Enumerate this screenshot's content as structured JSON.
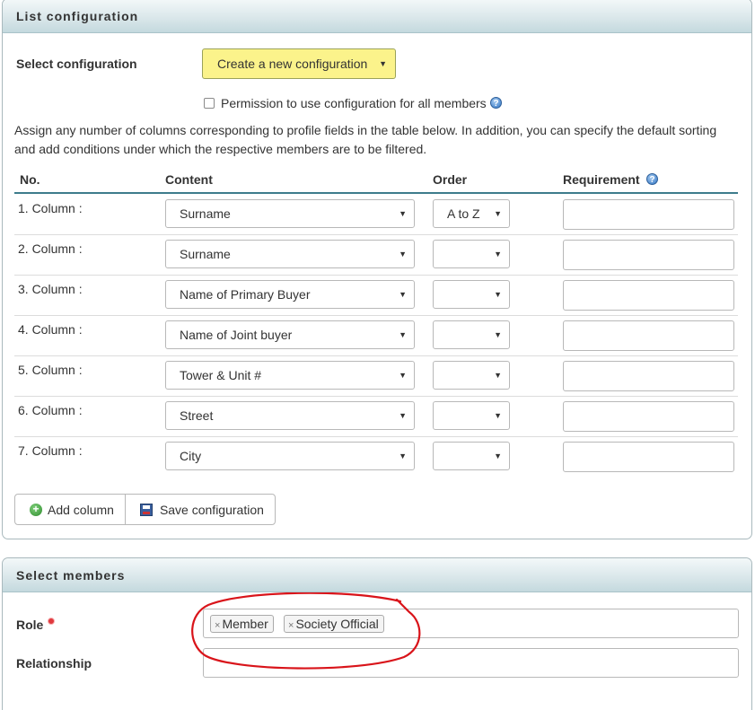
{
  "list_config": {
    "title": "List configuration",
    "select_label": "Select configuration",
    "select_value": "Create a new configuration",
    "permission_label": "Permission to use configuration for all members",
    "description": "Assign any number of columns corresponding to profile fields in the table below. In addition, you can specify the default sorting and add conditions under which the respective members are to be filtered.",
    "headers": {
      "no": "No.",
      "content": "Content",
      "order": "Order",
      "requirement": "Requirement"
    },
    "rows": [
      {
        "label": "1. Column :",
        "content": "Surname",
        "order": "A to Z",
        "requirement": ""
      },
      {
        "label": "2. Column :",
        "content": "Surname",
        "order": "",
        "requirement": ""
      },
      {
        "label": "3. Column :",
        "content": "Name of Primary Buyer",
        "order": "",
        "requirement": ""
      },
      {
        "label": "4. Column :",
        "content": "Name of Joint buyer",
        "order": "",
        "requirement": ""
      },
      {
        "label": "5. Column :",
        "content": "Tower & Unit #",
        "order": "",
        "requirement": ""
      },
      {
        "label": "6. Column :",
        "content": "Street",
        "order": "",
        "requirement": ""
      },
      {
        "label": "7. Column :",
        "content": "City",
        "order": "",
        "requirement": ""
      }
    ],
    "add_column_label": "Add column",
    "save_config_label": "Save configuration"
  },
  "select_members": {
    "title": "Select members",
    "role_label": "Role",
    "role_tags": [
      "Member",
      "Society Official"
    ],
    "relationship_label": "Relationship"
  },
  "icons": {
    "help": "help-icon",
    "add": "plus-circle-icon",
    "save": "floppy-disk-icon",
    "dropdown": "caret-down-icon"
  },
  "colors": {
    "highlight_select": "#fbf38b",
    "header_rule": "#3d7c8c",
    "required_dot": "#e0393e",
    "annotation": "#d9141a"
  },
  "caret_glyph": "▼",
  "help_glyph": "?",
  "plus_glyph": "+",
  "remove_glyph": "×"
}
